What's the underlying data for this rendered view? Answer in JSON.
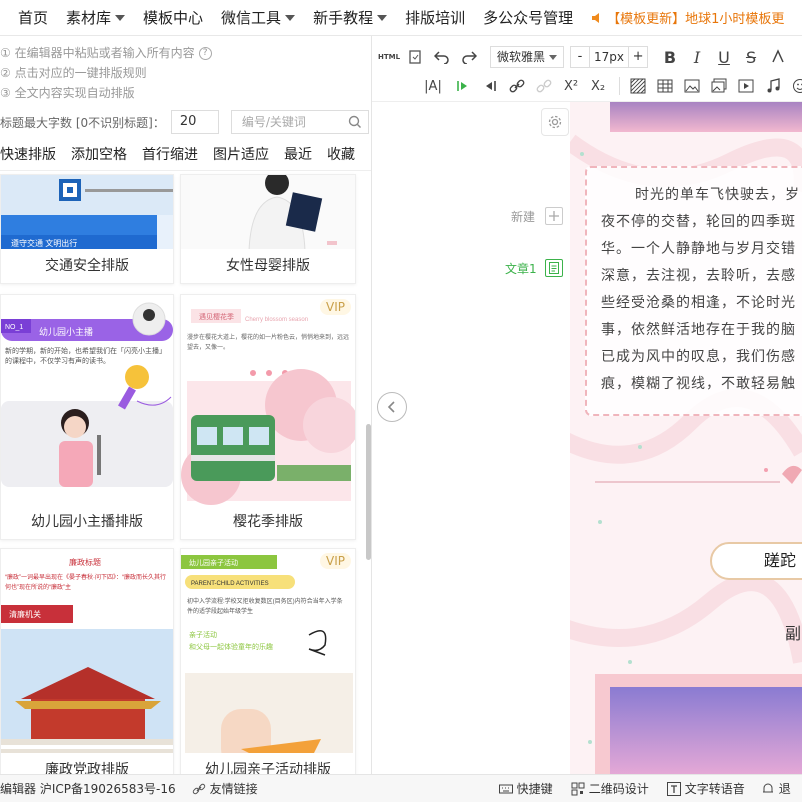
{
  "nav": {
    "items": [
      {
        "label": "首页",
        "dropdown": false
      },
      {
        "label": "素材库",
        "dropdown": true
      },
      {
        "label": "模板中心",
        "dropdown": false
      },
      {
        "label": "微信工具",
        "dropdown": true
      },
      {
        "label": "新手教程",
        "dropdown": true
      },
      {
        "label": "排版培训",
        "dropdown": false
      },
      {
        "label": "多公众号管理",
        "dropdown": false
      }
    ],
    "notice": "【模板更新】地球1小时模板更"
  },
  "left": {
    "tips": [
      "① 在编辑器中粘贴或者输入所有内容",
      "② 点击对应的一键排版规则",
      "③ 全文内容实现自动排版"
    ],
    "filter_label": "标题最大字数 [0不识别标题]：",
    "max_chars": "20",
    "search_placeholder": "编号/关键词",
    "tabs": [
      "快速排版",
      "添加空格",
      "首行缩进",
      "图片适应",
      "最近",
      "收藏"
    ],
    "cards": [
      {
        "caption": "交通安全排版",
        "banner": "遵守交通 文明出行",
        "vip": ""
      },
      {
        "caption": "女性母婴排版",
        "vip": ""
      },
      {
        "caption": "幼儿园小主播排版",
        "tag": "NO_1",
        "heading": "幼儿园小主播",
        "desc": "新的学期，新的开始，也希望我们在「闪亮小主播」的课程中，不仅学习有声的读书。",
        "vip": ""
      },
      {
        "caption": "樱花季排版",
        "heading": "遇见樱花季",
        "sub": "Cherry blossom season",
        "desc": "漫步在樱花大道上，樱花的如一片粉色云，悄悄地来到，远远望去，又像一。",
        "vip": "VIP"
      },
      {
        "caption": "廉政党政排版",
        "heading": "廉政标题",
        "desc": "“廉政”一词最早出现在《晏子春秋·问下四》：“廉政而长久其行何也”现在所说的“廉政”主",
        "ribbon": "清廉机关",
        "vip": ""
      },
      {
        "caption": "幼儿园亲子活动排版",
        "heading": "幼儿园亲子活动",
        "sub": "PARENT-CHILD ACTIVITIES",
        "desc": "初中入学流程:学校又拒收复数区(目务区)内符合当年入学条件的适学段起始年级学生",
        "title2": "亲子活动",
        "sub2": "和父母一起体验童年的乐趣",
        "vip": "VIP"
      }
    ]
  },
  "toolbar": {
    "font": "微软雅黑",
    "size": "17px",
    "minus": "-",
    "plus": "+",
    "html_label": "HTML",
    "bold": "B",
    "italic": "I",
    "underline": "U",
    "strike": "S",
    "superscript": "X²",
    "subscript": "X₂",
    "align": "|A|"
  },
  "side": {
    "new_label": "新建",
    "article_label": "文章1",
    "article_color": "#3bb24a"
  },
  "article": {
    "lines": [
      "时光的单车飞快驶去，岁",
      "夜不停的交替，轮回的四季斑",
      "华。一个人静静地与岁月交错",
      "深意，去注视，去聆听，去感",
      "些经受沧桑的相逢，不论时光",
      "事，依然鲜活地存在于我的脑",
      "已成为风中的叹息，我们伤感",
      "痕，模糊了视线，不敢轻易触"
    ],
    "title": "蹉跎",
    "subtitle": "副"
  },
  "footer": {
    "icp": "编辑器 沪ICP备19026583号-16",
    "links": "友情链接",
    "shortcut": "快捷键",
    "qrcode": "二维码设计",
    "tts": "文字转语音",
    "more": "退"
  }
}
